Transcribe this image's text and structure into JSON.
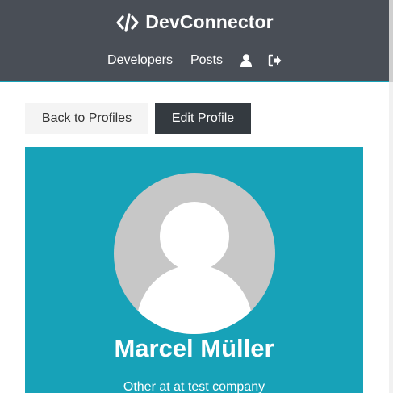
{
  "navbar": {
    "brand": "DevConnector",
    "brand_icon": "code-icon",
    "links": {
      "developers": "Developers",
      "posts": "Posts"
    },
    "icons": {
      "user": "user-icon",
      "logout": "sign-out-icon"
    },
    "background": "#494e56"
  },
  "actions": {
    "back": "Back to Profiles",
    "edit": "Edit Profile"
  },
  "profile": {
    "name": "Marcel Müller",
    "status": "Other at at test company",
    "avatar_icon": "default-avatar",
    "background": "#17a2b8"
  }
}
